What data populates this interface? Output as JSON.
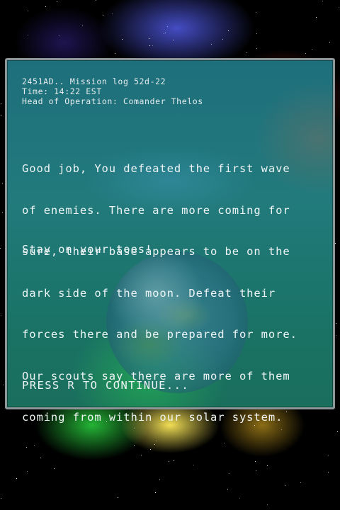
{
  "mission_log": {
    "header_lines": [
      "2451AD.. Mission log 52d-22",
      "Time: 14:22 EST",
      "Head of Operation: Comander Thelos"
    ],
    "body_lines": [
      "Good job, You defeated the first wave",
      "of enemies. There are more coming for",
      "sure, their base appears to be on the",
      "dark side of the moon. Defeat their",
      "forces there and be prepared for more.",
      "Our scouts say there are more of them",
      "coming from within our solar system."
    ],
    "sign_off": "Stay on your toes!",
    "continue_prompt": "PRESS R TO CONTINUE..."
  },
  "colors": {
    "panel_border": "#8d979a",
    "panel_fill": "#1e6f7c",
    "text": "#eef4f5"
  }
}
